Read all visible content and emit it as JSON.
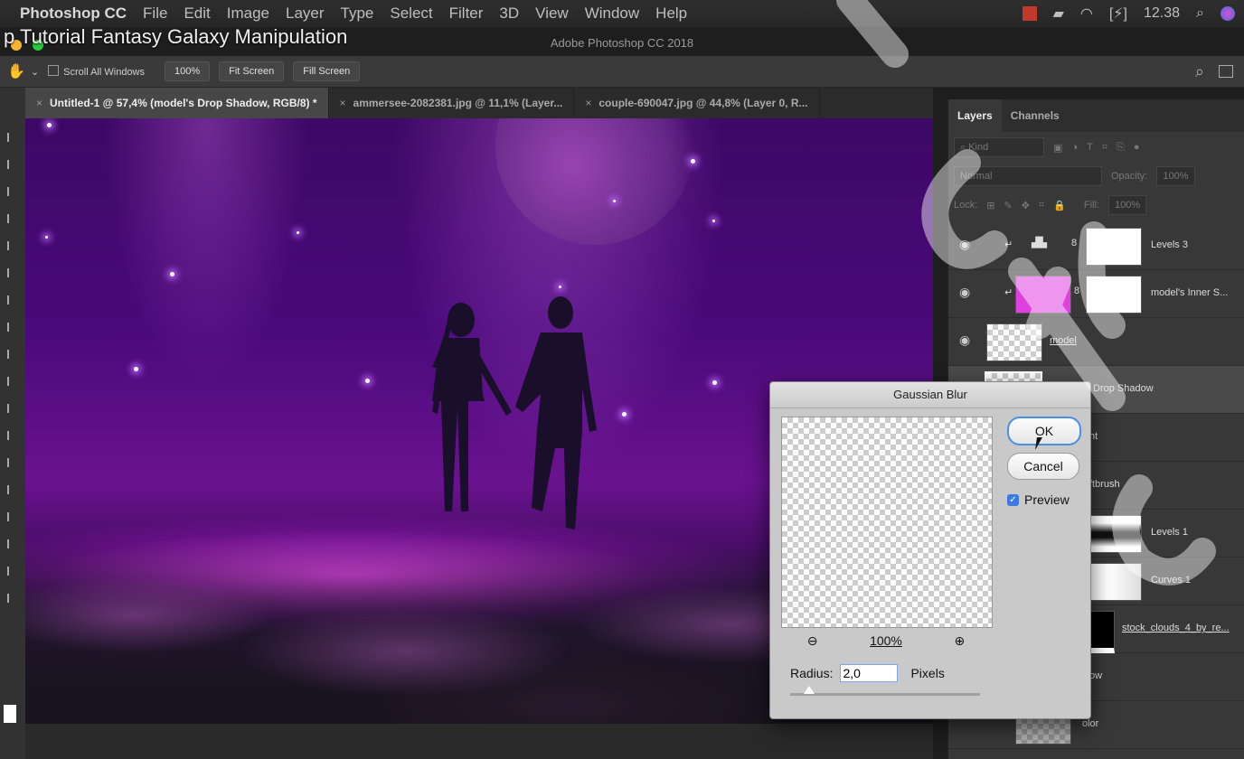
{
  "menubar": {
    "app": "Photoshop CC",
    "items": [
      "File",
      "Edit",
      "Image",
      "Layer",
      "Type",
      "Select",
      "Filter",
      "3D",
      "View",
      "Window",
      "Help"
    ],
    "time": "12.38"
  },
  "video_title": "p Tutorial Fantasy Galaxy Manipulation",
  "window_title": "Adobe Photoshop CC 2018",
  "options": {
    "scroll_all": "Scroll All Windows",
    "zoom100": "100%",
    "fit_screen": "Fit Screen",
    "fill_screen": "Fill Screen"
  },
  "tabs": [
    "Untitled-1 @ 57,4% (model's Drop Shadow, RGB/8) *",
    "ammersee-2082381.jpg @ 11,1% (Layer...",
    "couple-690047.jpg @ 44,8% (Layer 0, R..."
  ],
  "panel": {
    "tab_layers": "Layers",
    "tab_channels": "Channels",
    "kind": "Kind",
    "blend": "Normal",
    "opacity_label": "Opacity:",
    "opacity_value": "100%",
    "lock_label": "Lock:",
    "fill_label": "Fill:",
    "fill_value": "100%",
    "layers": [
      {
        "name": "Levels 3"
      },
      {
        "name": "model's Inner S..."
      },
      {
        "name": "model"
      },
      {
        "name": "Drop Shadow"
      },
      {
        "name": "ht"
      },
      {
        "name": "ftbrush"
      },
      {
        "name": "Levels 1"
      },
      {
        "name": "Curves 1"
      },
      {
        "name": "stock_clouds_4_by_re..."
      },
      {
        "name": "ow"
      },
      {
        "name": "olor"
      }
    ]
  },
  "dialog": {
    "title": "Gaussian Blur",
    "ok": "OK",
    "cancel": "Cancel",
    "preview": "Preview",
    "zoom": "100%",
    "radius_label": "Radius:",
    "radius_value": "2,0",
    "unit": "Pixels"
  },
  "colors": {
    "accent": "#4a90e2",
    "layer_pink": "#e040e0"
  }
}
